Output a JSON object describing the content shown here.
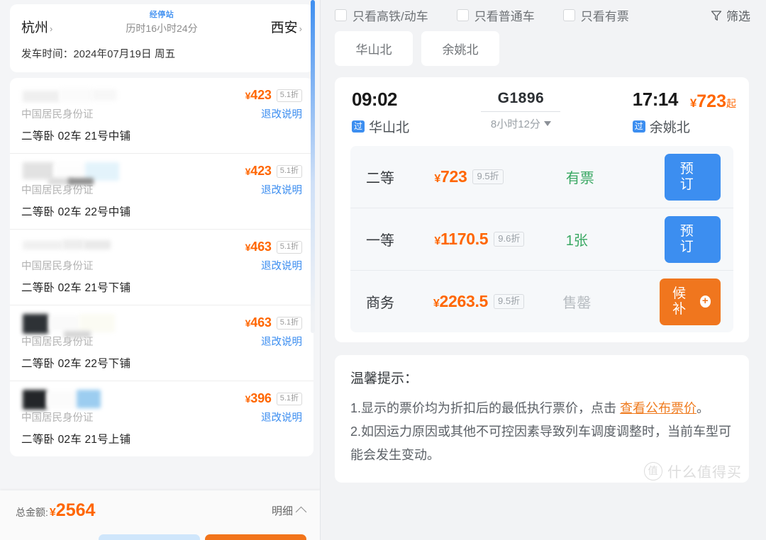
{
  "left": {
    "journey": {
      "from_city": "杭州",
      "to_city": "西安",
      "stop_label": "经停站",
      "duration": "历时16小时24分",
      "depart_line": "发车时间：2024年07月19日 周五",
      "chevron": "›"
    },
    "tickets": [
      {
        "price": "423",
        "yen": "¥",
        "discount": "5.1折",
        "id_type": "中国居民身份证",
        "refund_link": "退改说明",
        "seat": "二等卧 02车 21号中铺"
      },
      {
        "price": "423",
        "yen": "¥",
        "discount": "5.1折",
        "id_type": "中国居民身份证",
        "refund_link": "退改说明",
        "seat": "二等卧 02车 22号中铺"
      },
      {
        "price": "463",
        "yen": "¥",
        "discount": "5.1折",
        "id_type": "中国居民身份证",
        "refund_link": "退改说明",
        "seat": "二等卧 02车 21号下铺"
      },
      {
        "price": "463",
        "yen": "¥",
        "discount": "5.1折",
        "id_type": "中国居民身份证",
        "refund_link": "退改说明",
        "seat": "二等卧 02车 22号下铺"
      },
      {
        "price": "396",
        "yen": "¥",
        "discount": "5.1折",
        "id_type": "中国居民身份证",
        "refund_link": "退改说明",
        "seat": "二等卧 02车 21号上铺"
      }
    ],
    "summary": {
      "total_label": "总金额:",
      "total_yen": "¥",
      "total_amount": "2564",
      "detail_label": "明细"
    }
  },
  "right": {
    "filters": [
      {
        "label": "只看高铁/动车",
        "checked": false
      },
      {
        "label": "只看普通车",
        "checked": false
      },
      {
        "label": "只看有票",
        "checked": false
      }
    ],
    "filter_button": {
      "label": "筛选",
      "icon": "funnel-icon"
    },
    "station_chips": [
      "华山北",
      "余姚北"
    ],
    "train": {
      "depart_time": "09:02",
      "depart_badge": "过",
      "depart_station": "华山北",
      "train_no": "G1896",
      "duration": "8小时12分",
      "arrive_time": "17:14",
      "arrive_badge": "过",
      "arrive_station": "余姚北",
      "from_price_yen": "¥",
      "from_price": "723",
      "from_price_suffix": "起"
    },
    "seat_classes": [
      {
        "name": "二等",
        "yen": "¥",
        "price": "723",
        "discount": "9.5折",
        "stock": "有票",
        "stock_state": "avail",
        "action": "预订",
        "action_type": "book"
      },
      {
        "name": "一等",
        "yen": "¥",
        "price": "1170.5",
        "discount": "9.6折",
        "stock": "1张",
        "stock_state": "avail",
        "action": "预订",
        "action_type": "book"
      },
      {
        "name": "商务",
        "yen": "¥",
        "price": "2263.5",
        "discount": "9.5折",
        "stock": "售罄",
        "stock_state": "sold",
        "action": "候补",
        "action_type": "waitlist"
      }
    ],
    "tips": {
      "title": "温馨提示：",
      "line1_pre": "1.显示的票价均为折扣后的最低执行票价，点击 ",
      "line1_link": "查看公布票价",
      "line1_post": "。",
      "line2": "2.如因运力原因或其他不可控因素导致列车调度调整时，当前车型可能会发生变动。"
    },
    "watermark": {
      "mark": "值",
      "text": "什么值得买"
    }
  },
  "colors": {
    "accent_orange": "#ff6600",
    "accent_blue": "#3c8ef0",
    "success_green": "#3aa863",
    "waitlist_orange": "#f0761e"
  }
}
